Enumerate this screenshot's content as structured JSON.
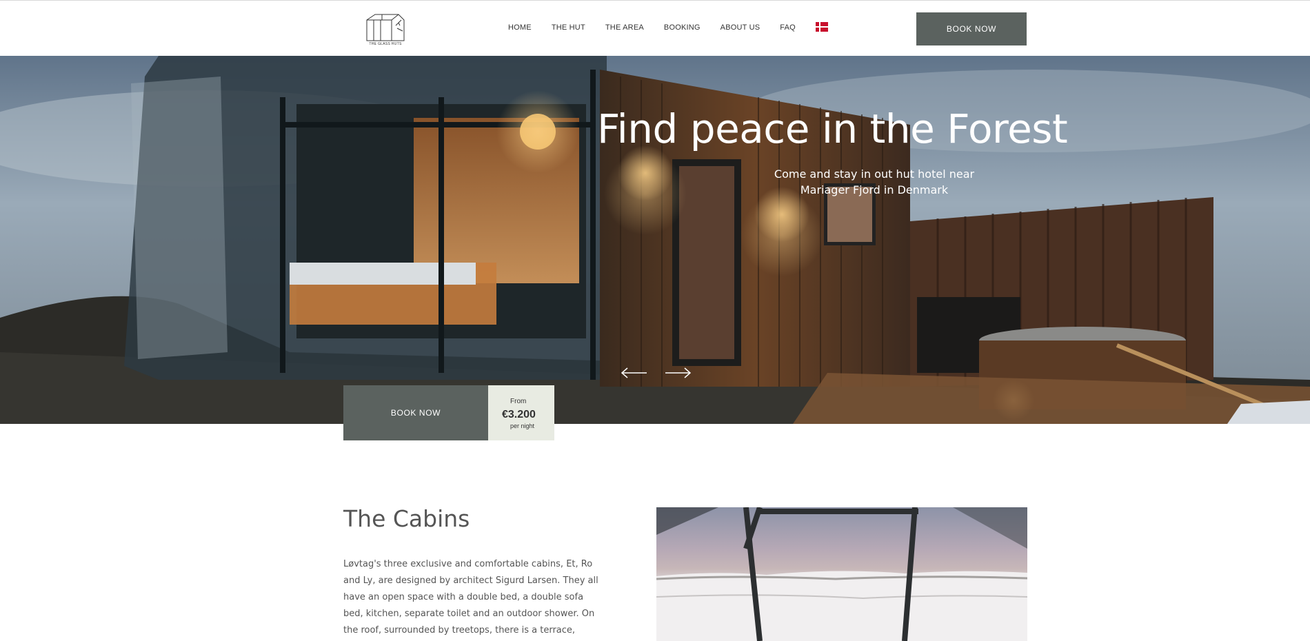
{
  "header": {
    "logo_text": "THE GLASS HUTS",
    "nav": [
      "HOME",
      "THE HUT",
      "THE AREA",
      "BOOKING",
      "ABOUT US",
      "FAQ"
    ],
    "language_flag": "danish-flag",
    "book_now_label": "BOOK NOW"
  },
  "hero": {
    "title": "Find peace in the Forest",
    "subtitle": "Come and stay in out hut hotel near Mariager Fjord in Denmark"
  },
  "booking_strip": {
    "book_now_label": "BOOK NOW",
    "from_label": "From",
    "price": "€3.200",
    "per_label": "per night"
  },
  "cabins": {
    "title": "The Cabins",
    "text": "Løvtag's three exclusive and comfortable cabins, Et, Ro and Ly, are designed by architect Sigurd Larsen. They all have an open space with a double bed, a double sofa bed, kitchen, separate toilet and an outdoor shower. On the roof, surrounded by treetops, there is a terrace, which is about nine meters above"
  },
  "colors": {
    "button_bg": "#5b625f",
    "price_bg": "#e8ebe2",
    "text": "#555555"
  }
}
